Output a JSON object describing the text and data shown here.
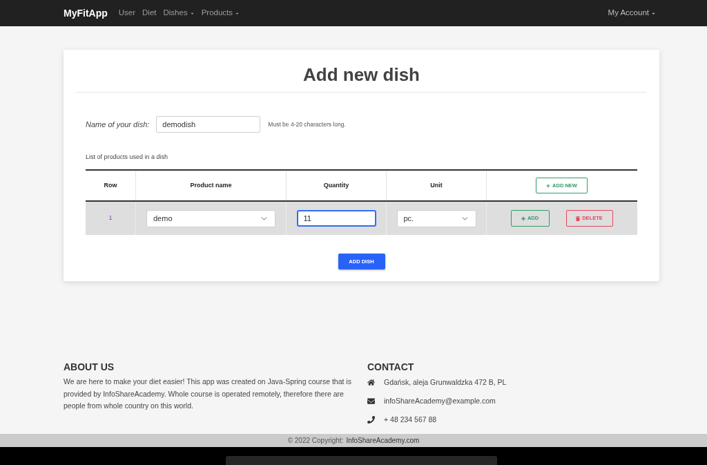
{
  "navbar": {
    "brand": "MyFitApp",
    "items": [
      {
        "label": "User",
        "dropdown": false
      },
      {
        "label": "Diet",
        "dropdown": false
      },
      {
        "label": "Dishes",
        "dropdown": true
      },
      {
        "label": "Products",
        "dropdown": true
      }
    ],
    "account": {
      "label": "My Account",
      "dropdown": true
    }
  },
  "card": {
    "title": "Add new dish",
    "name_field": {
      "label": "Name of your dish:",
      "value": "demodish",
      "hint": "Must be 4-20 characters long."
    },
    "table_caption": "List of products used in a dish",
    "table": {
      "columns": [
        "Row",
        "Product name",
        "Quantity",
        "Unit"
      ],
      "header_button": "ADD NEW",
      "rows": [
        {
          "row": "1",
          "product": "demo",
          "quantity": "11",
          "quantity_focused": true,
          "unit": "pc.",
          "buttons": [
            {
              "kind": "add",
              "label": "ADD"
            },
            {
              "kind": "delete",
              "label": "DELETE"
            }
          ]
        }
      ]
    },
    "submit_button": "ADD DISH"
  },
  "footer": {
    "about": {
      "heading": "ABOUT US",
      "text": "We are here to make your diet easier! This app was created on Java-Spring course that is provided by InfoShareAcademy. Whole course is operated remotely, therefore there are people from whole country on this world."
    },
    "contact": {
      "heading": "CONTACT",
      "items": [
        {
          "kind": "address",
          "text": "Gdańsk, aleja Grunwaldzka 472 B, PL"
        },
        {
          "kind": "email",
          "text": "infoShareAcademy@example.com"
        },
        {
          "kind": "phone",
          "text": "+ 48 234 567 88"
        }
      ]
    },
    "copyright": {
      "text": "© 2022 Copyright:",
      "link": "InfoShareAcademy.com"
    }
  }
}
